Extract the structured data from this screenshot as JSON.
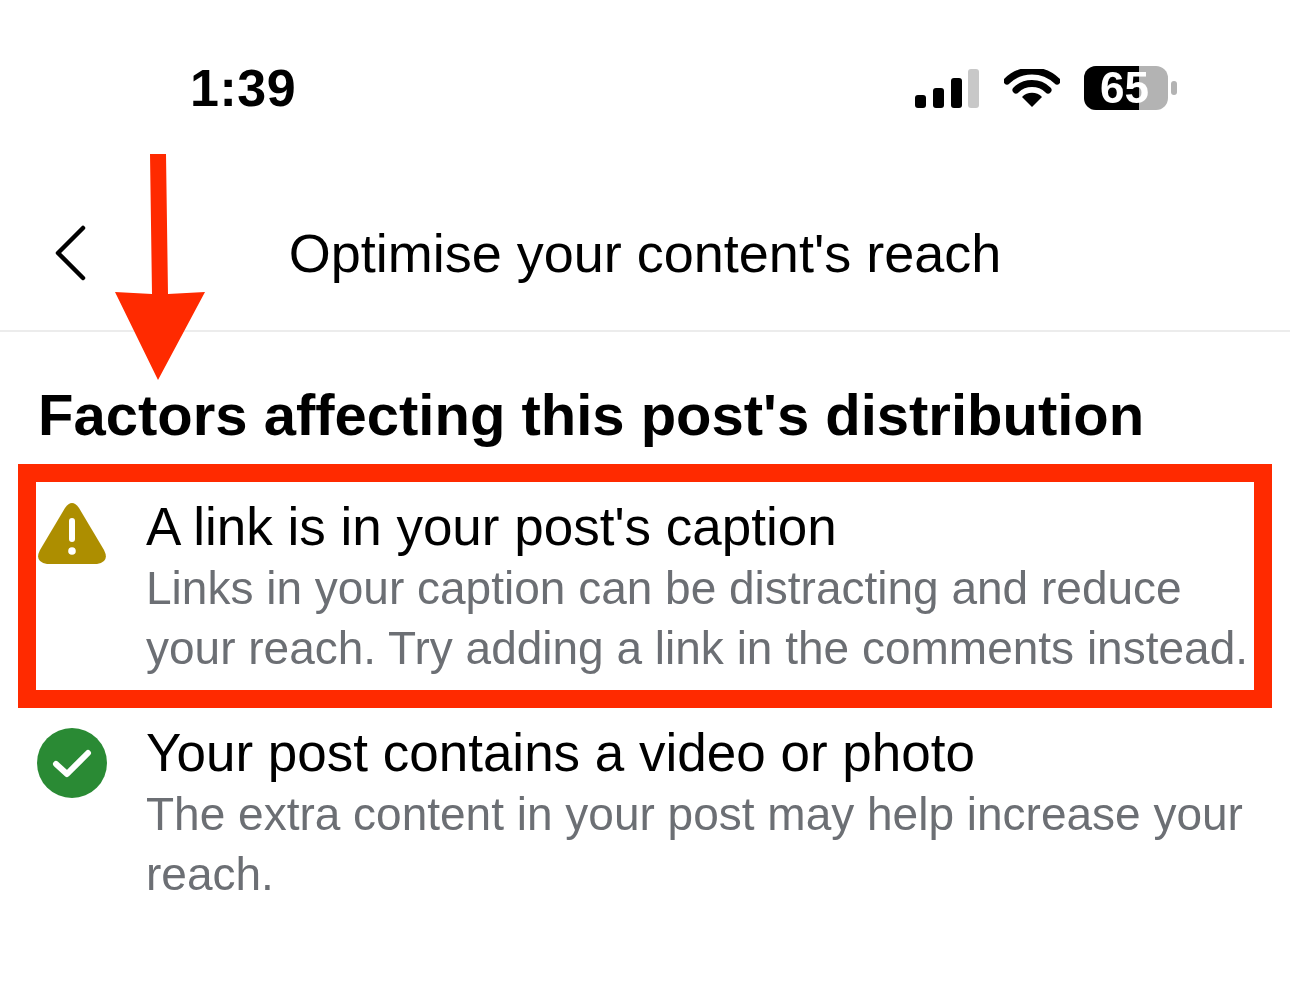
{
  "status_bar": {
    "time": "1:39",
    "battery": "65"
  },
  "header": {
    "title": "Optimise your content's reach"
  },
  "section_title": "Factors affecting this post's distribution",
  "factors": [
    {
      "kind": "warning",
      "title": "A link is in your post's caption",
      "description": "Links in your caption can be distracting and reduce your reach. Try adding a link in the comments instead.",
      "highlighted": true
    },
    {
      "kind": "passed",
      "title": "Your post contains a video or photo",
      "description": "The extra content in your post may help increase your reach.",
      "highlighted": false
    }
  ],
  "annotations": [
    {
      "kind": "arrow"
    }
  ]
}
